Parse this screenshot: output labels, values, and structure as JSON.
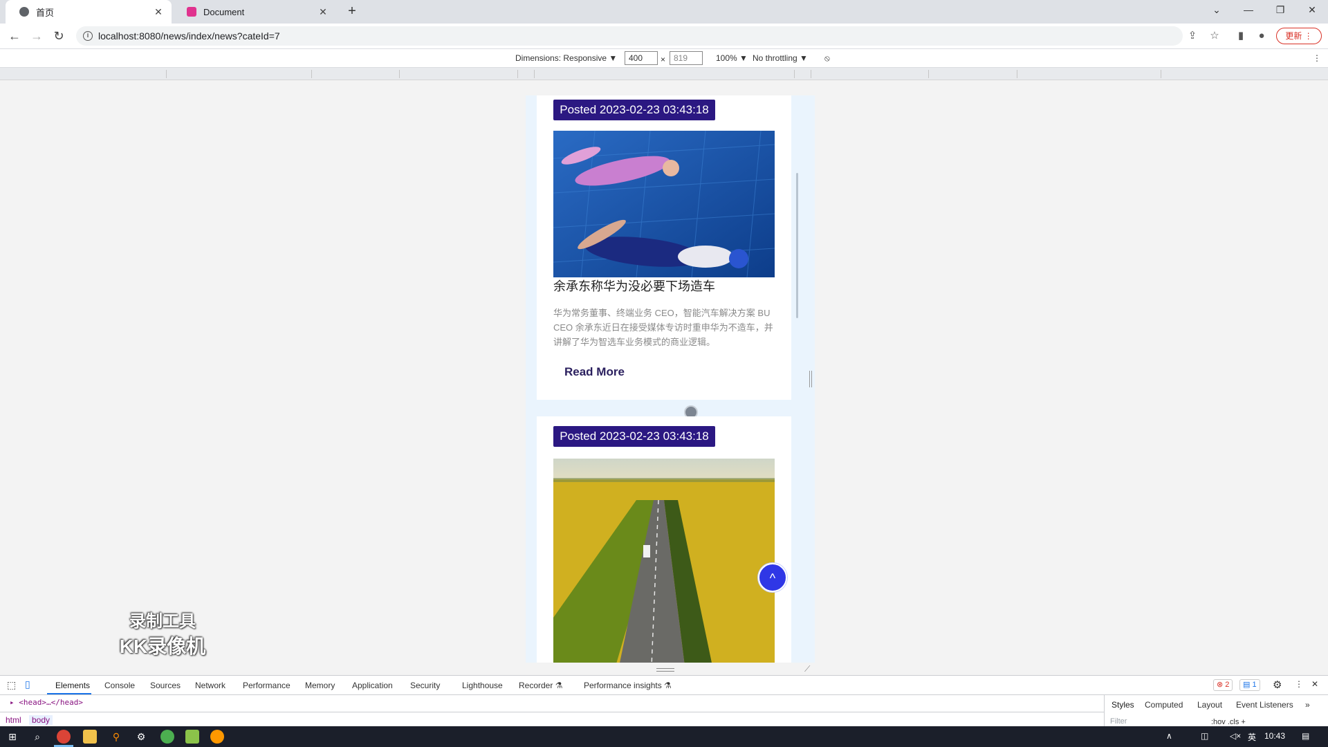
{
  "browser": {
    "tabs": [
      {
        "label": "首页",
        "close": "✕"
      },
      {
        "label": "Document",
        "close": "✕"
      }
    ],
    "new_tab": "+",
    "window_controls": [
      "⌄",
      "—",
      "❐",
      "✕"
    ],
    "url": "localhost:8080/news/index/news?cateId=7",
    "update_label": "更新",
    "update_menu": "⋮"
  },
  "device_toolbar": {
    "dimensions_label": "Dimensions: Responsive ▼",
    "width": "400",
    "times": "×",
    "height": "819",
    "zoom": "100% ▼",
    "throttling": "No throttling ▼",
    "more": "⋮"
  },
  "page": {
    "cards": [
      {
        "posted": "Posted 2023-02-23 03:43:18",
        "title": "余承东称华为没必要下场造车",
        "summary": "华为常务董事、终端业务 CEO，智能汽车解决方案 BU CEO 余承东近日在接受媒体专访时重申华为不造车，并讲解了华为智选车业务模式的商业逻辑。",
        "read_more": "Read More"
      },
      {
        "posted": "Posted 2023-02-23 03:43:18"
      }
    ],
    "back_to_top": "^"
  },
  "watermark": {
    "line1": "录制工具",
    "line2": "KK录像机"
  },
  "devtools": {
    "tabs": [
      "Elements",
      "Console",
      "Sources",
      "Network",
      "Performance",
      "Memory",
      "Application",
      "Security",
      "Lighthouse",
      "Recorder ⚗",
      "Performance insights ⚗"
    ],
    "errors": "⊗ 2",
    "messages": "▤ 1",
    "dom_line": "▸ <head>…</head>",
    "breadcrumbs": [
      "html",
      "body"
    ],
    "side_tabs": [
      "Styles",
      "Computed",
      "Layout",
      "Event Listeners",
      "»"
    ],
    "filter_placeholder": "Filter",
    "filter_tools": ":hov  .cls  +"
  },
  "taskbar": {
    "time": "10:43",
    "ime": "英"
  },
  "colors": {
    "posted_bg": "#2b1882",
    "back_to_top": "#2f37e6",
    "update_button": "#d93025"
  }
}
